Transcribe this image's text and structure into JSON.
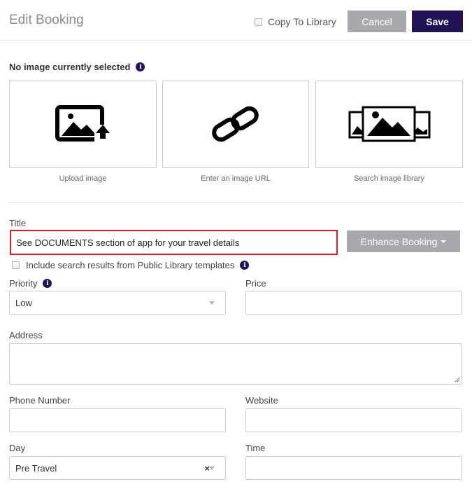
{
  "header": {
    "title": "Edit Booking",
    "copy_to_library_label": "Copy To Library",
    "cancel_label": "Cancel",
    "save_label": "Save"
  },
  "image_section": {
    "status": "No image currently selected",
    "options": [
      {
        "label": "Upload image",
        "icon": "upload-image-icon"
      },
      {
        "label": "Enter an image URL",
        "icon": "link-icon"
      },
      {
        "label": "Search image library",
        "icon": "image-gallery-icon"
      }
    ]
  },
  "form": {
    "title_label": "Title",
    "title_value": "See DOCUMENTS section of app for your travel details",
    "enhance_label": "Enhance Booking",
    "include_public_label": "Include search results from Public Library templates",
    "priority_label": "Priority",
    "priority_value": "Low",
    "price_label": "Price",
    "price_value": "",
    "address_label": "Address",
    "address_value": "",
    "phone_label": "Phone Number",
    "phone_value": "",
    "website_label": "Website",
    "website_value": "",
    "day_label": "Day",
    "day_value": "Pre Travel",
    "day_clear": "×",
    "time_label": "Time",
    "time_value": ""
  },
  "colors": {
    "primary": "#241257",
    "secondary_button": "#a7a9ac",
    "highlight_border": "#e01b22"
  }
}
